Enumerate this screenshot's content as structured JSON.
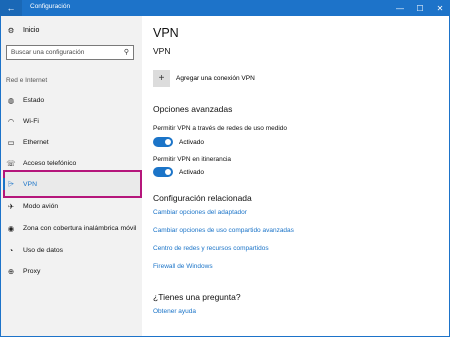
{
  "window": {
    "title": "Configuración",
    "controls": [
      "—",
      "☐",
      "✕"
    ]
  },
  "sidebar": {
    "home_label": "Inicio",
    "search_placeholder": "Buscar una configuración",
    "section_title": "Red e Internet",
    "items": [
      {
        "label": "Estado",
        "icon": "status-icon"
      },
      {
        "label": "Wi-Fi",
        "icon": "wifi-icon"
      },
      {
        "label": "Ethernet",
        "icon": "ethernet-icon"
      },
      {
        "label": "Acceso telefónico",
        "icon": "dialup-icon"
      },
      {
        "label": "VPN",
        "icon": "vpn-icon"
      },
      {
        "label": "Modo avión",
        "icon": "airplane-icon"
      },
      {
        "label": "Zona con cobertura inalámbrica móvil",
        "icon": "hotspot-icon"
      },
      {
        "label": "Uso de datos",
        "icon": "data-usage-icon"
      },
      {
        "label": "Proxy",
        "icon": "proxy-icon"
      }
    ]
  },
  "main": {
    "page_title": "VPN",
    "vpn_section": "VPN",
    "add_vpn_label": "Agregar una conexión VPN",
    "advanced_title": "Opciones avanzadas",
    "metered_label": "Permitir VPN a través de redes de uso medido",
    "metered_state": "Activado",
    "roaming_label": "Permitir VPN en itinerancia",
    "roaming_state": "Activado",
    "related_title": "Configuración relacionada",
    "related_links": [
      "Cambiar opciones del adaptador",
      "Cambiar opciones de uso compartido avanzadas",
      "Centro de redes y recursos compartidos",
      "Firewall de Windows"
    ],
    "question_title": "¿Tienes una pregunta?",
    "help_link": "Obtener ayuda"
  },
  "colors": {
    "accent": "#1b74c8",
    "titlebar": "#1d73c9",
    "highlight": "#b5167b"
  }
}
